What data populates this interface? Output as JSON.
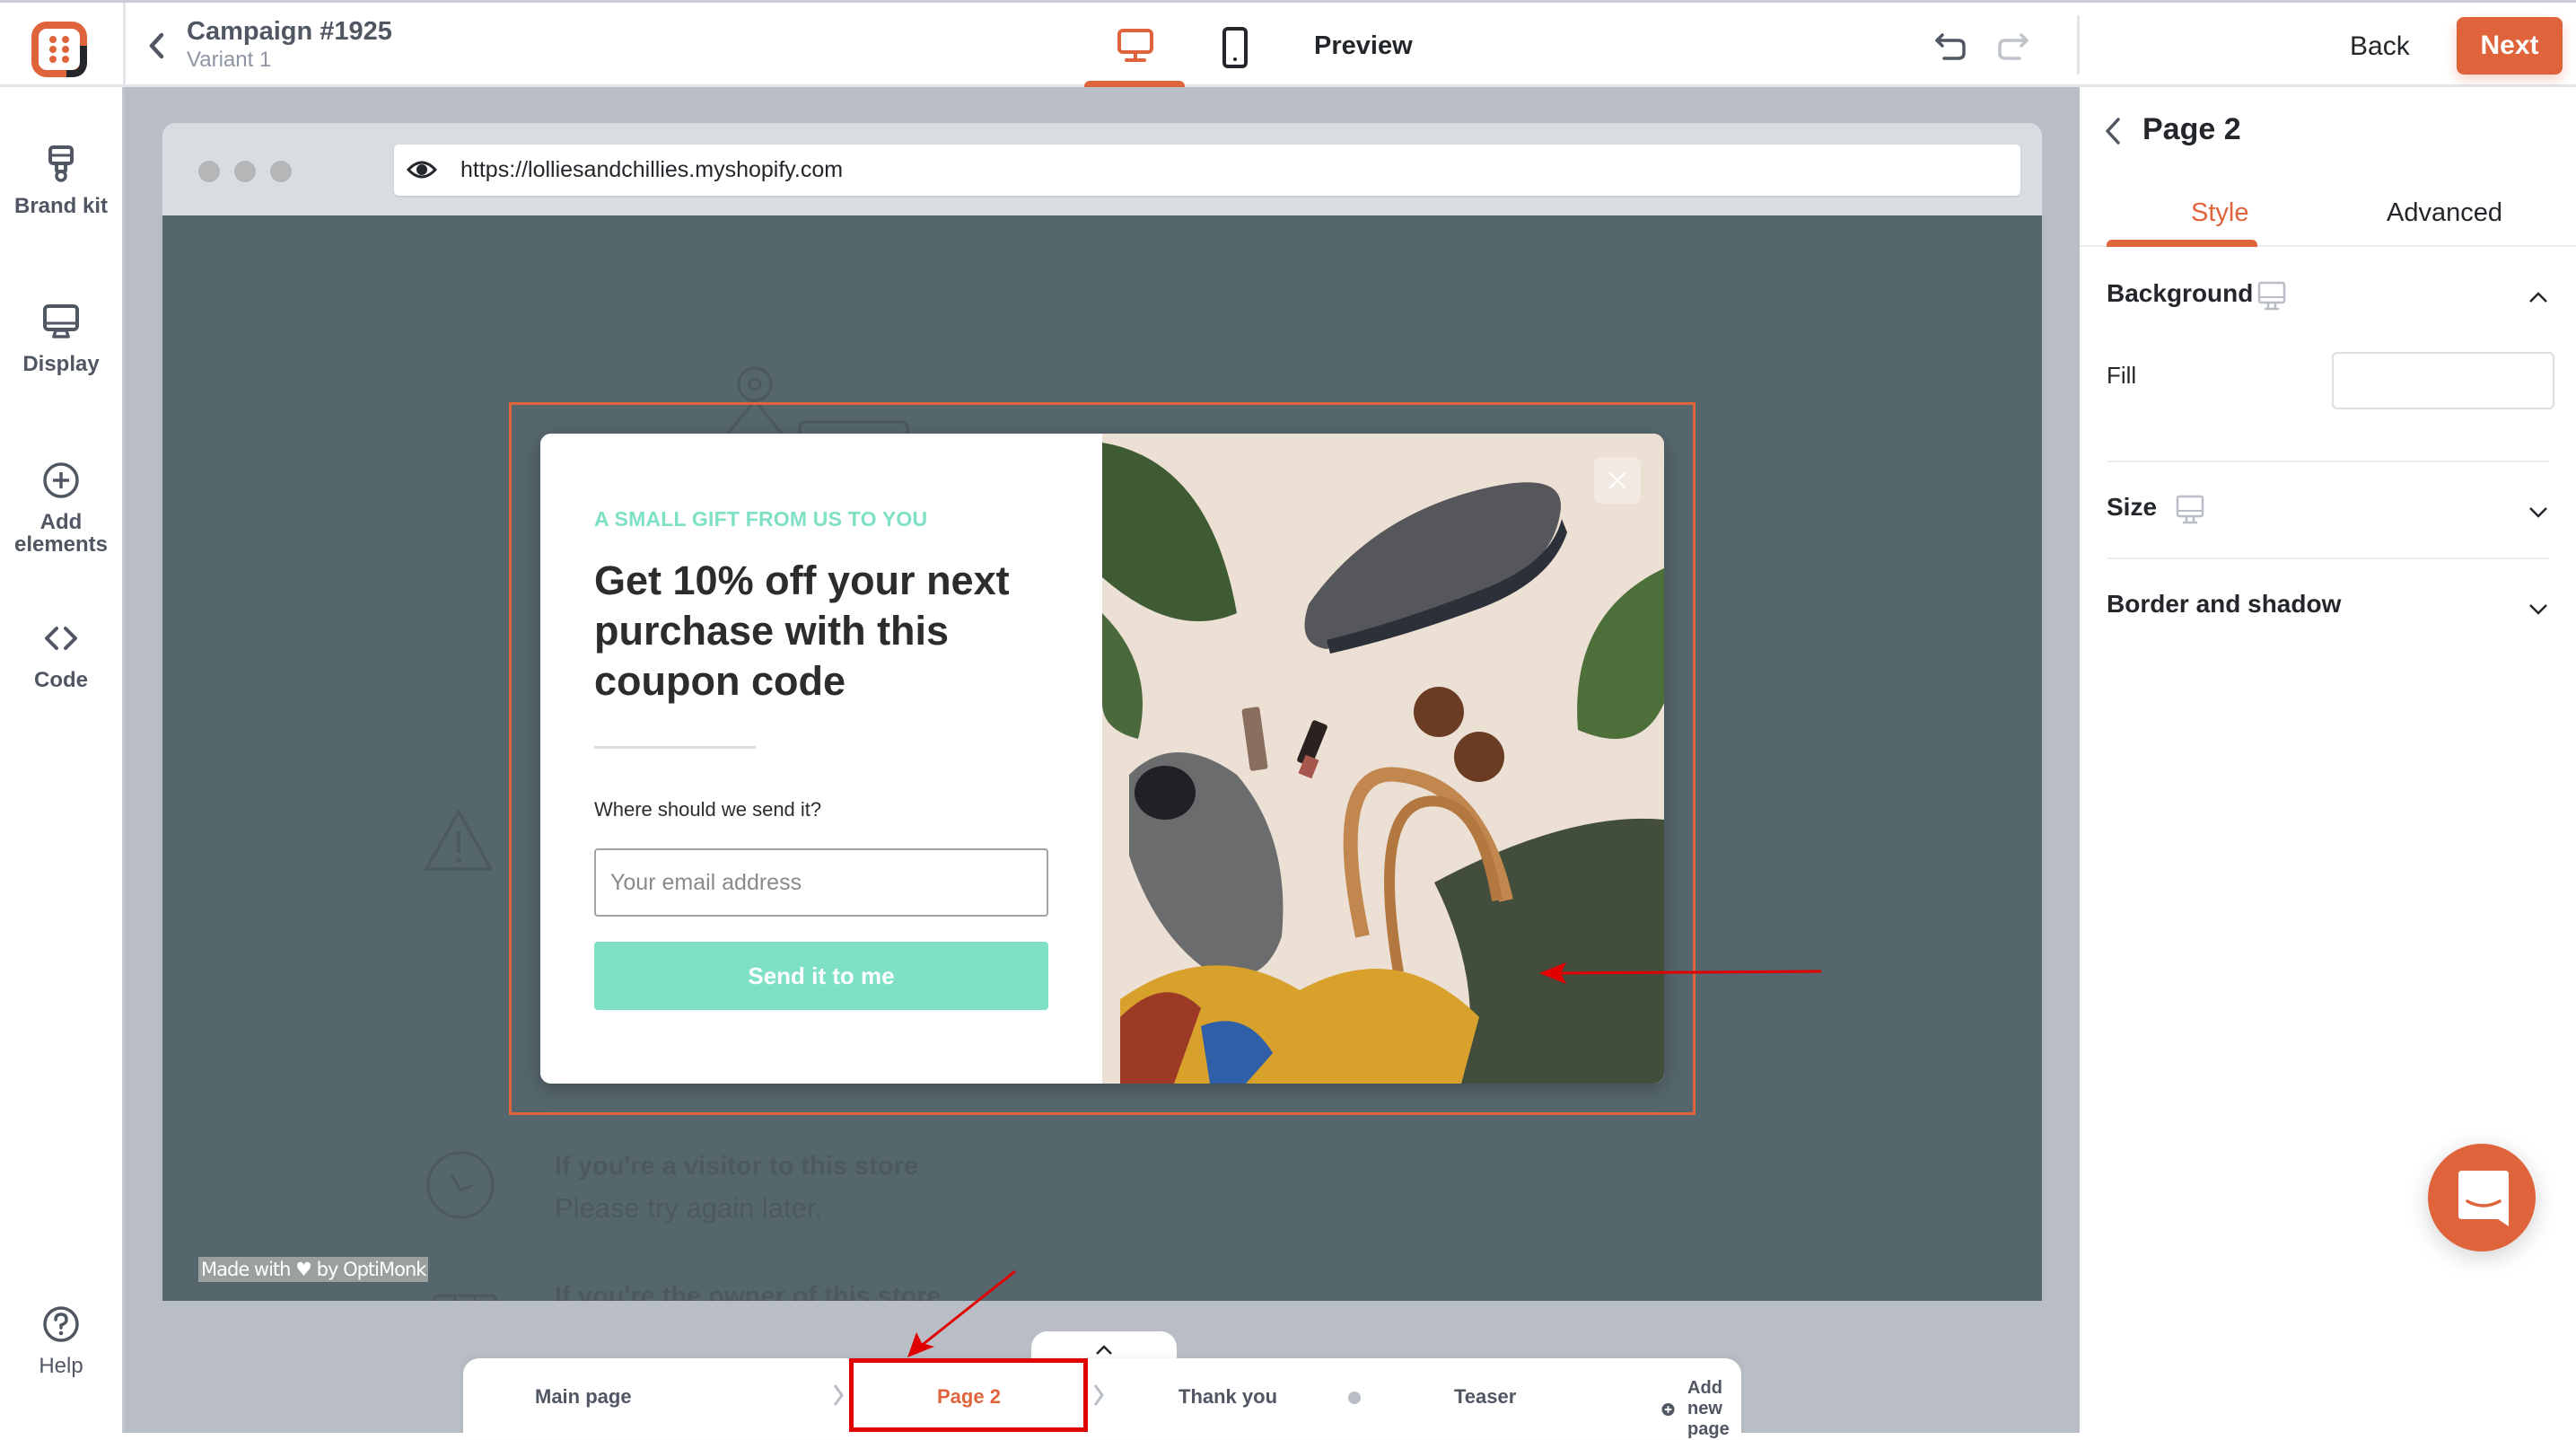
{
  "app": {
    "logo": "optimonk-logo-icon",
    "campaign_title": "Campaign #1925",
    "variant": "Variant 1"
  },
  "topbar": {
    "devices": [
      {
        "name": "desktop",
        "icon": "desktop-icon",
        "active": true
      },
      {
        "name": "mobile",
        "icon": "mobile-icon",
        "active": false
      }
    ],
    "preview_label": "Preview",
    "undo_icon": "undo-icon",
    "redo_icon": "redo-icon",
    "back_label": "Back",
    "next_label": "Next"
  },
  "sidebar": {
    "items": [
      {
        "label": "Brand kit",
        "icon": "paint-roller-icon"
      },
      {
        "label": "Display",
        "icon": "monitor-icon"
      },
      {
        "label": "Add elements",
        "icon": "plus-circle-icon"
      },
      {
        "label": "Code",
        "icon": "code-icon"
      }
    ],
    "help_label": "Help"
  },
  "browser": {
    "url": "https://lolliesandchillies.myshopify.com"
  },
  "store_page": {
    "visitor_title": "If you're a visitor to this store",
    "visitor_text": "Please try again later.",
    "owner_title": "If you're the owner of this store",
    "made_with": "Made with ♥ by OptiMonk"
  },
  "popup": {
    "kicker": "A SMALL GIFT FROM US TO YOU",
    "headline": "Get 10% off your next purchase with this coupon code",
    "question": "Where should we send it?",
    "email_placeholder": "Your email address",
    "email_value": "",
    "submit_label": "Send it to me",
    "accent_color": "#7ee0c4",
    "image_description": "flat-lay of sneakers, sunglasses, lipstick, leaves, scarf and leather bag"
  },
  "page_tabs": {
    "tabs": [
      {
        "label": "Main page",
        "active": false
      },
      {
        "label": "Page 2",
        "active": true
      },
      {
        "label": "Thank you",
        "active": false
      },
      {
        "label": "Teaser",
        "active": false
      }
    ],
    "add_label": "Add new page"
  },
  "right_panel": {
    "title": "Page 2",
    "tabs": [
      {
        "label": "Style",
        "active": true
      },
      {
        "label": "Advanced",
        "active": false
      }
    ],
    "sections": [
      {
        "title": "Background",
        "expanded": true,
        "device_icon": true
      },
      {
        "title": "Size",
        "expanded": false,
        "device_icon": true
      },
      {
        "title": "Border and shadow",
        "expanded": false,
        "device_icon": false
      }
    ],
    "fill_label": "Fill",
    "fill_value": ""
  },
  "colors": {
    "brand": "#e0643b",
    "annotation_red": "#e00000",
    "popup_accent": "#7ee0c4",
    "canvas_bg": "#b9bec6",
    "site_bg": "#55676d"
  }
}
